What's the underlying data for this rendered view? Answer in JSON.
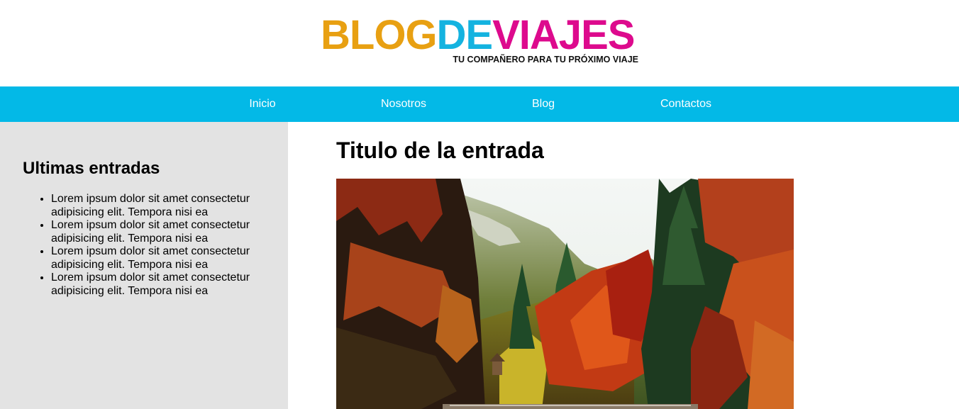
{
  "header": {
    "logo": {
      "part1": "BLOG",
      "part2": "DE",
      "part3": "VIAJES",
      "tagline": "TU COMPAÑERO PARA TU PRÓXIMO VIAJE",
      "colors": {
        "part1": "#e8a012",
        "part2": "#14b3e0",
        "part3": "#dd0a8d"
      }
    }
  },
  "nav": {
    "background": "#03b9e7",
    "items": [
      {
        "label": "Inicio"
      },
      {
        "label": "Nosotros"
      },
      {
        "label": "Blog"
      },
      {
        "label": "Contactos"
      }
    ]
  },
  "sidebar": {
    "title": "Ultimas entradas",
    "items": [
      {
        "text": "Lorem ipsum dolor sit amet consectetur adipisicing elit. Tempora nisi ea"
      },
      {
        "text": "Lorem ipsum dolor sit amet consectetur adipisicing elit. Tempora nisi ea"
      },
      {
        "text": "Lorem ipsum dolor sit amet consectetur adipisicing elit. Tempora nisi ea"
      },
      {
        "text": "Lorem ipsum dolor sit amet consectetur adipisicing elit. Tempora nisi ea"
      }
    ]
  },
  "main": {
    "title": "Titulo de la entrada",
    "image_icon": "autumn-forest-photo"
  }
}
